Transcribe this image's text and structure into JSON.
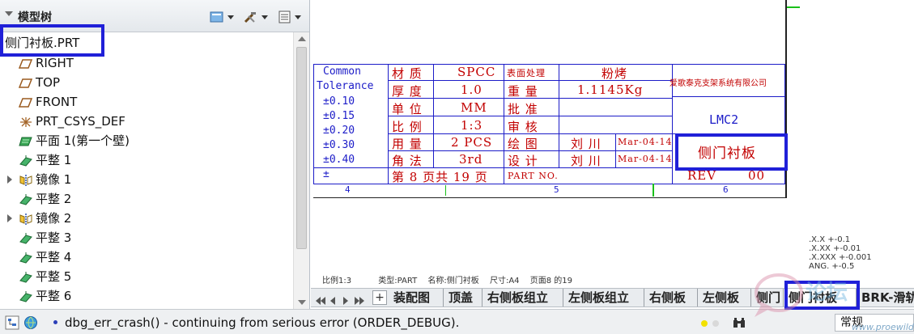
{
  "tree": {
    "title": "模型树",
    "root": "侧门衬板.PRT",
    "items": [
      {
        "label": "RIGHT",
        "icon": "datum-plane-icon",
        "expandable": false
      },
      {
        "label": "TOP",
        "icon": "datum-plane-icon",
        "expandable": false
      },
      {
        "label": "FRONT",
        "icon": "datum-plane-icon",
        "expandable": false
      },
      {
        "label": "PRT_CSYS_DEF",
        "icon": "coordinate-system-icon",
        "expandable": false
      },
      {
        "label": "平面 1(第一个壁)",
        "icon": "sheetmetal-wall-icon",
        "expandable": false
      },
      {
        "label": "平整 1",
        "icon": "flat-wall-icon",
        "expandable": false
      },
      {
        "label": "镜像 1",
        "icon": "mirror-icon",
        "expandable": true
      },
      {
        "label": "平整 2",
        "icon": "flat-wall-icon",
        "expandable": false
      },
      {
        "label": "镜像 2",
        "icon": "mirror-icon",
        "expandable": true
      },
      {
        "label": "平整 3",
        "icon": "flat-wall-icon",
        "expandable": false
      },
      {
        "label": "平整 4",
        "icon": "flat-wall-icon",
        "expandable": false
      },
      {
        "label": "平整 5",
        "icon": "flat-wall-icon",
        "expandable": false
      },
      {
        "label": "平整 6",
        "icon": "flat-wall-icon",
        "expandable": false
      }
    ]
  },
  "title_block": {
    "tolerance": {
      "h1": "Common",
      "h2": "Tolerance",
      "vals": [
        "±0.10",
        "±0.15",
        "±0.20",
        "±0.30",
        "±0.40",
        "±"
      ]
    },
    "labels": {
      "material": "材  质",
      "thickness": "厚  度",
      "unit": "单  位",
      "scale": "比  例",
      "usage": "用  量",
      "angle": "角  法",
      "surface": "表面处理",
      "weight": "重  量",
      "approve": "批  准",
      "check": "审  核",
      "draw": "绘  图",
      "design": "设  计",
      "part_no": "PART NO."
    },
    "values": {
      "material": "SPCC",
      "thickness": "1.0",
      "unit": "MM",
      "scale": "1:3",
      "usage": "2 PCS",
      "angle": "3rd",
      "surface": "粉烤",
      "weight": "1.1145Kg",
      "draw_name": "刘  川",
      "design_name": "刘  川",
      "draw_date": "Mar-04-14",
      "design_date": "Mar-04-14"
    },
    "page_text": "第 8 页共 19 页",
    "company": "爱歌泰克支架系统有限公司",
    "code": "LMC2",
    "part_name": "侧门衬板",
    "rev_label": "REV",
    "rev": "00",
    "zones": [
      "4",
      "5",
      "6"
    ]
  },
  "sheet_info": {
    "scale": "比例1:3",
    "type": "类型:PART",
    "name": "名称:侧门衬板",
    "size": "尺寸:A4",
    "page": "页面8  的19"
  },
  "tolerance_note": [
    ".X.X  +-0.1",
    ".X.XX  +-0.01",
    ".X.XXX  +-0.001",
    "ANG.  +-0.5"
  ],
  "tabs": [
    "装配图",
    "顶盖",
    "右侧板组立",
    "左侧板组立",
    "右侧板",
    "左侧板",
    "侧门",
    "侧门衬板",
    "BRK-滑轨"
  ],
  "active_tab": "侧门衬板",
  "status": {
    "message": "dbg_err_crash() - continuing from serious error (ORDER_DEBUG).",
    "mode": "常规"
  },
  "watermark_url": "www.proewildfire.cn",
  "colors": {
    "accent_blue": "#2020d8",
    "title_red": "#c20000",
    "title_blue": "#1c1cc8"
  }
}
